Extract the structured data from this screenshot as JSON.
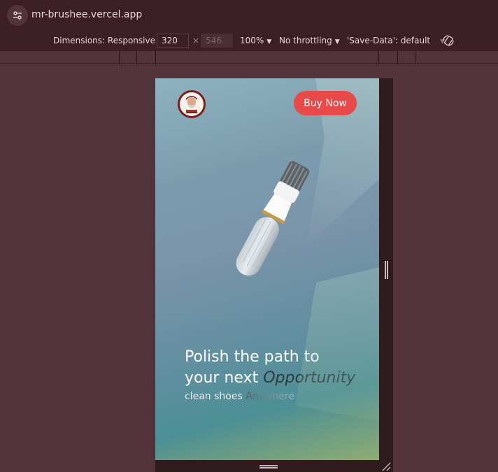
{
  "browser": {
    "url": "mr-brushee.vercel.app",
    "icons": {
      "site_info": "tune-icon",
      "rotate": "rotate-icon"
    }
  },
  "device_toolbar": {
    "dimensions_label": "Dimensions: Responsive",
    "width": "320",
    "times": "×",
    "height": "546",
    "zoom": "100%",
    "throttling": "No throttling",
    "save_data": "'Save-Data': default"
  },
  "page": {
    "buy_button": "Buy Now",
    "headline_line1": "Polish the path to",
    "headline_line2_prefix": "your next ",
    "headline_line2_em": "Opportunity",
    "sub_prefix": "clean shoes ",
    "sub_fade": "Anywhere",
    "colors": {
      "accent": "#e84949",
      "logo_ring": "#7a1d1d"
    }
  }
}
